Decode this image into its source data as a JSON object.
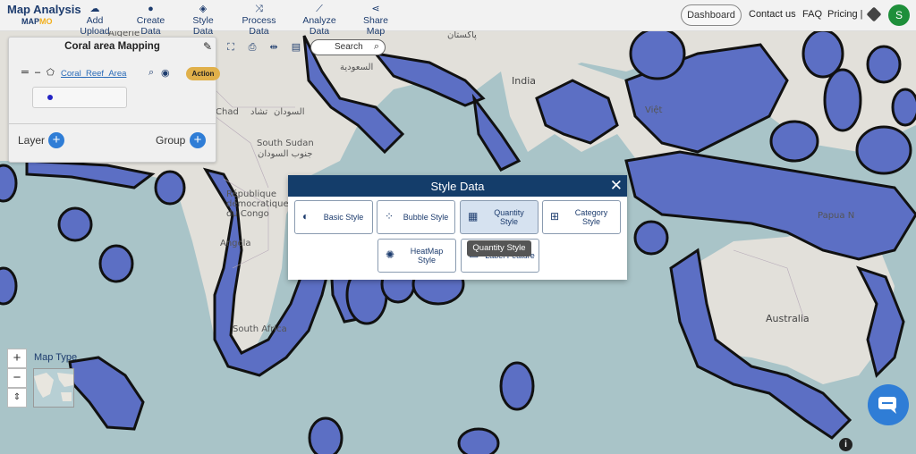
{
  "header": {
    "logo_main": "Map Analysis",
    "logo_sub_a": "MAP",
    "logo_sub_b": "MO",
    "nav": [
      {
        "label": "Add Upload",
        "icon": "cloud-upload-icon"
      },
      {
        "label": "Create Data",
        "icon": "map-pin-icon"
      },
      {
        "label": "Style Data",
        "icon": "paint-bucket-icon"
      },
      {
        "label": "Process Data",
        "icon": "process-icon"
      },
      {
        "label": "Analyze Data",
        "icon": "analyze-icon"
      },
      {
        "label": "Share Map",
        "icon": "share-icon"
      }
    ],
    "dashboard": "Dashboard",
    "contact": "Contact us",
    "faq": "FAQ",
    "pricing": "Pricing |",
    "avatar_letter": "S"
  },
  "panel": {
    "title": "Coral area Mapping",
    "layer_name": "Coral_Reef_Area",
    "action_label": "Action",
    "layer_label": "Layer",
    "group_label": "Group"
  },
  "toolbar": {
    "search_label": "Search"
  },
  "modal": {
    "title": "Style Data",
    "buttons": [
      {
        "label1": "Basic Style",
        "label2": ""
      },
      {
        "label1": "Bubble Style",
        "label2": ""
      },
      {
        "label1": "Quantity",
        "label2": "Style"
      },
      {
        "label1": "Category",
        "label2": "Style"
      },
      {
        "label1": "HeatMap",
        "label2": "Style"
      },
      {
        "label1": "Label Feature",
        "label2": ""
      }
    ],
    "tooltip": "Quantity Style"
  },
  "map": {
    "map_type_label": "Map Type",
    "places": [
      "Algérie",
      "السعودية",
      "پاکستان",
      "India",
      "Việt",
      "تشاد",
      "السودان",
      "Chad",
      "South Sudan",
      "جنوب السودان",
      "République démocratique du Congo",
      "Angola",
      "South Africa",
      "Papua N",
      "Australia"
    ],
    "colors": {
      "water": "#a9c4c8",
      "land": "#e2e0da",
      "coral": "#5c6fc4",
      "accent": "#143d6a"
    }
  }
}
